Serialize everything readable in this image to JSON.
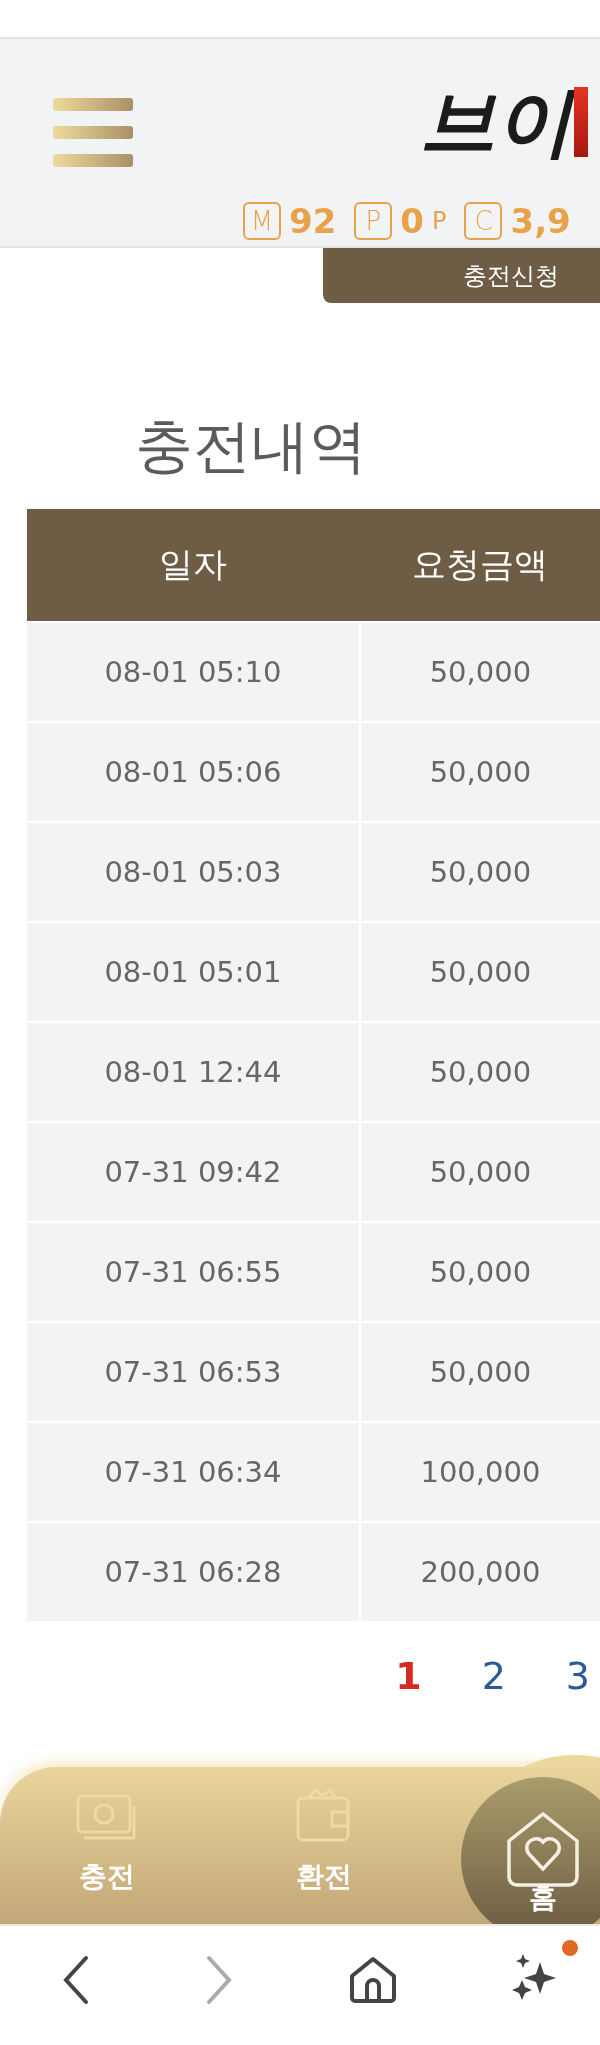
{
  "header": {
    "logo": "브이",
    "balances": [
      {
        "symbol": "M",
        "value": "92"
      },
      {
        "symbol": "P",
        "value": "0",
        "unit": "P"
      },
      {
        "symbol": "C",
        "value": "3,9"
      }
    ]
  },
  "action_button": "충전신청",
  "title": "충전내역",
  "table": {
    "columns": [
      "일자",
      "요청금액"
    ],
    "rows": [
      [
        "08-01 05:10",
        "50,000"
      ],
      [
        "08-01 05:06",
        "50,000"
      ],
      [
        "08-01 05:03",
        "50,000"
      ],
      [
        "08-01 05:01",
        "50,000"
      ],
      [
        "08-01 12:44",
        "50,000"
      ],
      [
        "07-31 09:42",
        "50,000"
      ],
      [
        "07-31 06:55",
        "50,000"
      ],
      [
        "07-31 06:53",
        "50,000"
      ],
      [
        "07-31 06:34",
        "100,000"
      ],
      [
        "07-31 06:28",
        "200,000"
      ]
    ]
  },
  "pagination": [
    {
      "label": "1",
      "selected": true
    },
    {
      "label": "2",
      "selected": false
    },
    {
      "label": "3",
      "selected": false
    }
  ],
  "bottom_nav": [
    {
      "label": "충전",
      "kind": "charge"
    },
    {
      "label": "환전",
      "kind": "exchange"
    },
    {
      "label": "홈",
      "kind": "home"
    }
  ],
  "browser_bar": {
    "forward_disabled": true,
    "notification": true
  }
}
